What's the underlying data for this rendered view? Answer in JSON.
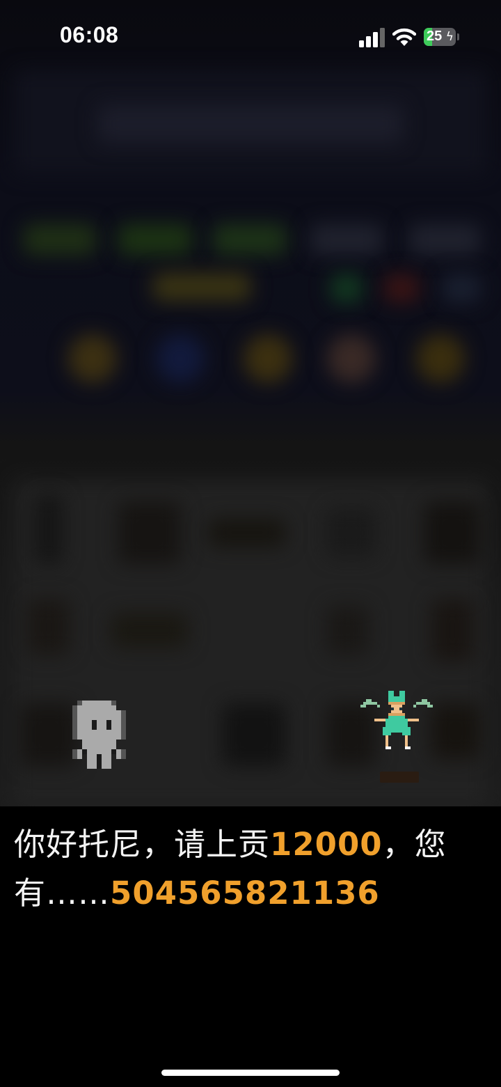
{
  "status_bar": {
    "time": "06:08",
    "battery_percent": "25",
    "battery_level": 0.25,
    "icons": [
      "cellular-signal-icon",
      "wifi-icon",
      "battery-charging-icon"
    ]
  },
  "scene": {
    "left_character": "ghost-tony-sprite",
    "right_character": "green-winged-sprite",
    "background": "blurred-game-interior"
  },
  "dialogue": {
    "part1": "你好托尼，请上贡",
    "amount": "12000",
    "part2": "，您有……",
    "balance": "504565821136"
  },
  "colors": {
    "highlight": "#f0a02c",
    "dialogue_text": "#f4f4f4",
    "dialogue_bg": "#000000",
    "battery_fill": "#3ecb5a"
  }
}
